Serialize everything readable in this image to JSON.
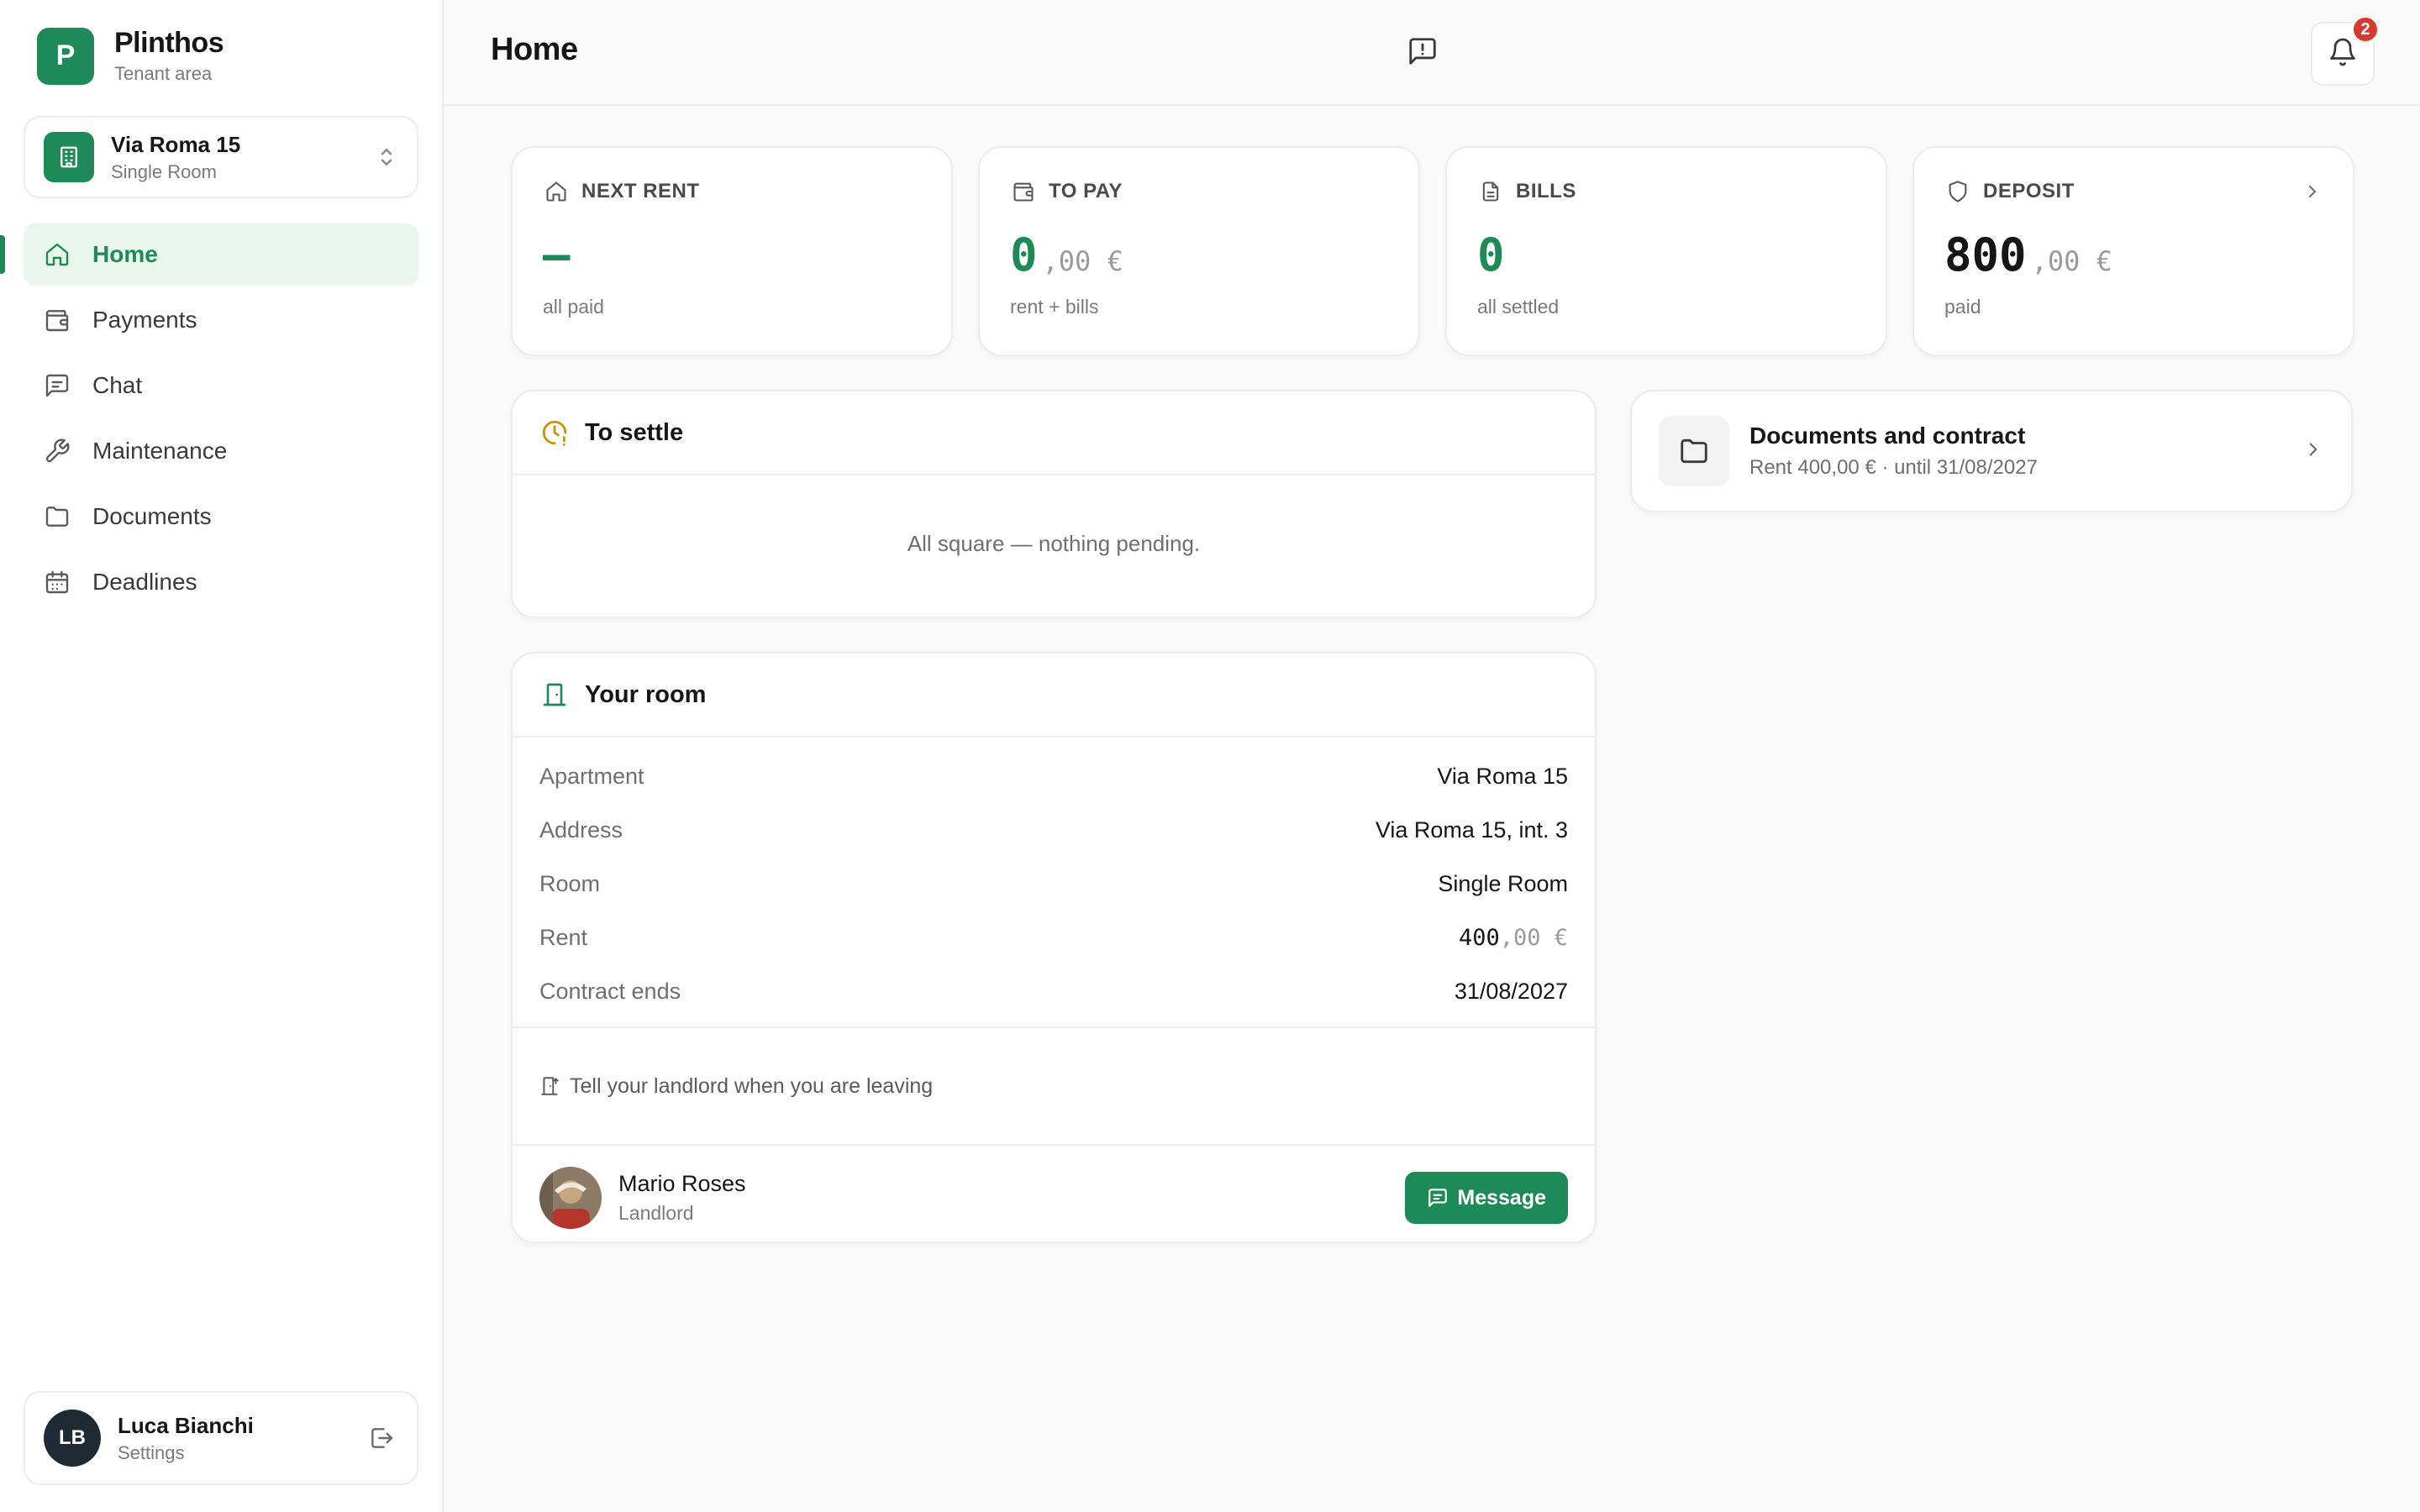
{
  "brand": {
    "logo_letter": "P",
    "name": "Plinthos",
    "subtitle": "Tenant area"
  },
  "property": {
    "name": "Via Roma 15",
    "room": "Single Room"
  },
  "nav": [
    {
      "label": "Home",
      "icon": "home-icon",
      "active": true
    },
    {
      "label": "Payments",
      "icon": "wallet-icon"
    },
    {
      "label": "Chat",
      "icon": "chat-icon"
    },
    {
      "label": "Maintenance",
      "icon": "wrench-icon"
    },
    {
      "label": "Documents",
      "icon": "folder-icon"
    },
    {
      "label": "Deadlines",
      "icon": "calendar-icon"
    }
  ],
  "user": {
    "initials": "LB",
    "name": "Luca Bianchi",
    "subtitle": "Settings"
  },
  "header": {
    "title": "Home",
    "notifications": "2"
  },
  "stats": {
    "next_rent": {
      "label": "NEXT RENT",
      "value": "—",
      "sub": "all paid"
    },
    "to_pay": {
      "label": "TO PAY",
      "value_int": "0",
      "value_dec": ",00 €",
      "sub": "rent + bills"
    },
    "bills": {
      "label": "BILLS",
      "value": "0",
      "sub": "all settled"
    },
    "deposit": {
      "label": "DEPOSIT",
      "value_int": "800",
      "value_dec": ",00 €",
      "sub": "paid"
    }
  },
  "to_settle": {
    "title": "To settle",
    "empty": "All square — nothing pending."
  },
  "room": {
    "title": "Your room",
    "rows": {
      "apartment": {
        "k": "Apartment",
        "v": "Via Roma 15"
      },
      "address": {
        "k": "Address",
        "v": "Via Roma 15, int. 3"
      },
      "room": {
        "k": "Room",
        "v": "Single Room"
      },
      "rent": {
        "k": "Rent",
        "v_int": "400",
        "v_dec": ",00 €"
      },
      "contract_ends": {
        "k": "Contract ends",
        "v": "31/08/2027"
      }
    },
    "leave_link": "Tell your landlord when you are leaving",
    "landlord": {
      "name": "Mario Roses",
      "role": "Landlord",
      "button": "Message"
    }
  },
  "documents": {
    "title": "Documents and contract",
    "sub": "Rent 400,00 € · until 31/08/2027"
  },
  "colors": {
    "accent": "#1e8a57",
    "accent_bg": "#e8f6ee",
    "badge": "#d63a2f",
    "clock": "#c9930e"
  }
}
